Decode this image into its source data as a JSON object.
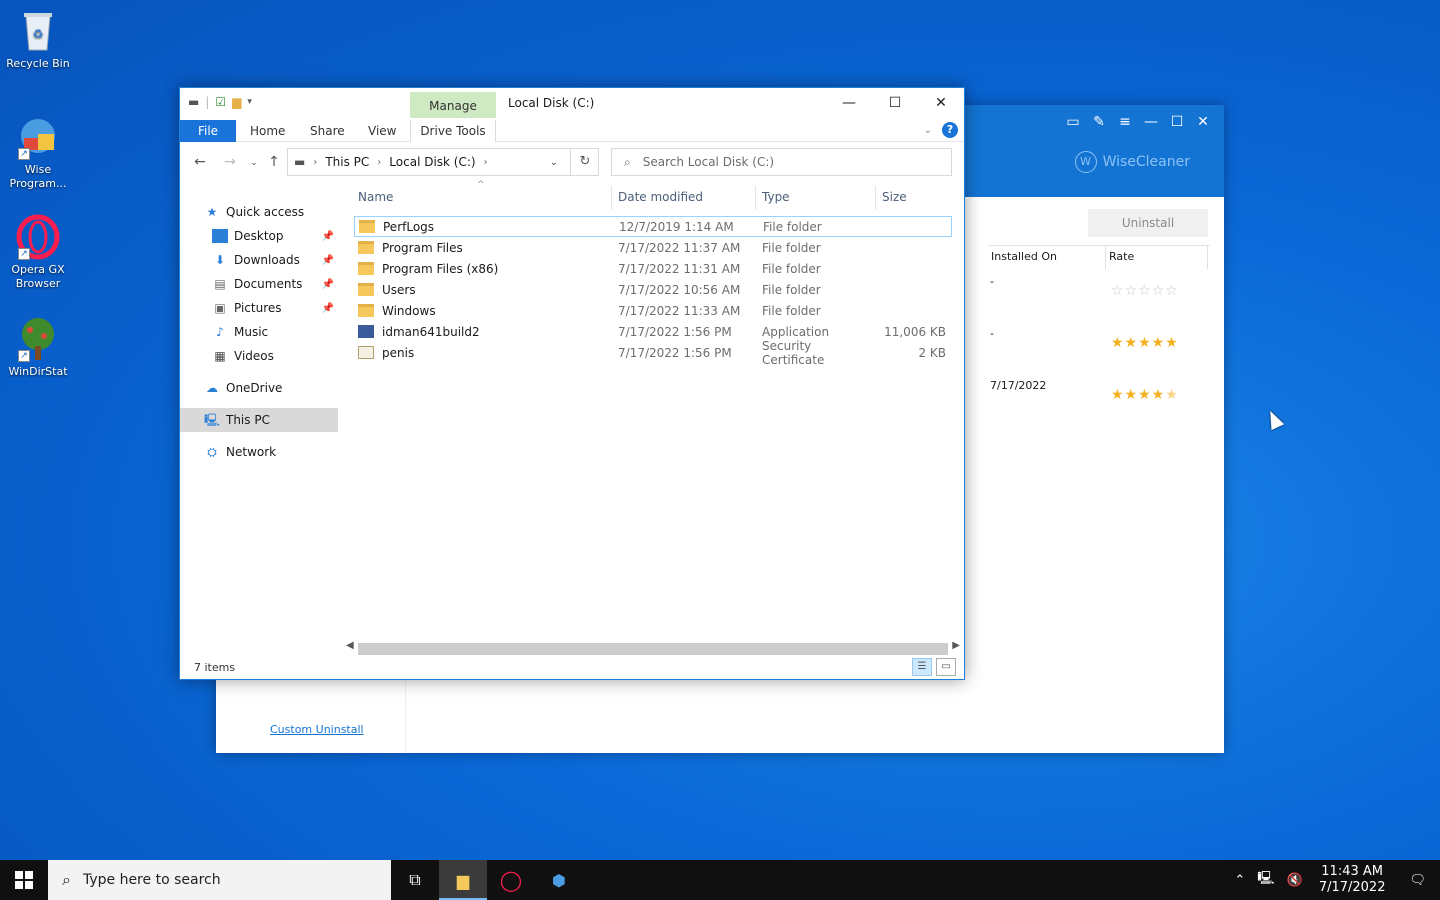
{
  "desktop": {
    "icons": [
      {
        "label": "Recycle Bin"
      },
      {
        "label": "Wise Program..."
      },
      {
        "label": "Opera GX Browser"
      },
      {
        "label": "WinDirStat"
      }
    ]
  },
  "wise": {
    "brand": "WiseCleaner",
    "brand_letter": "W",
    "uninstall_label": "Uninstall",
    "columns": [
      "Installed On",
      "Rate"
    ],
    "rows": [
      {
        "installed_on": "-",
        "rating": 0
      },
      {
        "installed_on": "-",
        "rating": 5
      },
      {
        "installed_on": "7/17/2022",
        "rating": 4.5
      }
    ],
    "custom_uninstall": "Custom Uninstall"
  },
  "explorer": {
    "manage_tab": "Manage",
    "title": "Local Disk (C:)",
    "ribbon_tabs": {
      "file": "File",
      "home": "Home",
      "share": "Share",
      "view": "View",
      "drive_tools": "Drive Tools"
    },
    "address": {
      "this_pc": "This PC",
      "local_disk": "Local Disk (C:)"
    },
    "search_placeholder": "Search Local Disk (C:)",
    "nav": {
      "quick_access": "Quick access",
      "desktop": "Desktop",
      "downloads": "Downloads",
      "documents": "Documents",
      "pictures": "Pictures",
      "music": "Music",
      "videos": "Videos",
      "onedrive": "OneDrive",
      "this_pc": "This PC",
      "network": "Network"
    },
    "columns": {
      "name": "Name",
      "date": "Date modified",
      "type": "Type",
      "size": "Size"
    },
    "files": [
      {
        "name": "PerfLogs",
        "date": "12/7/2019 1:14 AM",
        "type": "File folder",
        "size": "",
        "icon": "folder-icon"
      },
      {
        "name": "Program Files",
        "date": "7/17/2022 11:37 AM",
        "type": "File folder",
        "size": "",
        "icon": "folder-icon"
      },
      {
        "name": "Program Files (x86)",
        "date": "7/17/2022 11:31 AM",
        "type": "File folder",
        "size": "",
        "icon": "folder-icon"
      },
      {
        "name": "Users",
        "date": "7/17/2022 10:56 AM",
        "type": "File folder",
        "size": "",
        "icon": "folder-icon"
      },
      {
        "name": "Windows",
        "date": "7/17/2022 11:33 AM",
        "type": "File folder",
        "size": "",
        "icon": "folder-icon"
      },
      {
        "name": "idman641build2",
        "date": "7/17/2022 1:56 PM",
        "type": "Application",
        "size": "11,006 KB",
        "icon": "application-icon"
      },
      {
        "name": "penis",
        "date": "7/17/2022 1:56 PM",
        "type": "Security Certificate",
        "size": "2 KB",
        "icon": "certificate-icon"
      }
    ],
    "status": "7 items"
  },
  "taskbar": {
    "search_placeholder": "Type here to search",
    "time": "11:43 AM",
    "date": "7/17/2022"
  },
  "colors": {
    "accent": "#1a73d9",
    "wise_header": "#1474d4",
    "star": "#f2b01e"
  }
}
